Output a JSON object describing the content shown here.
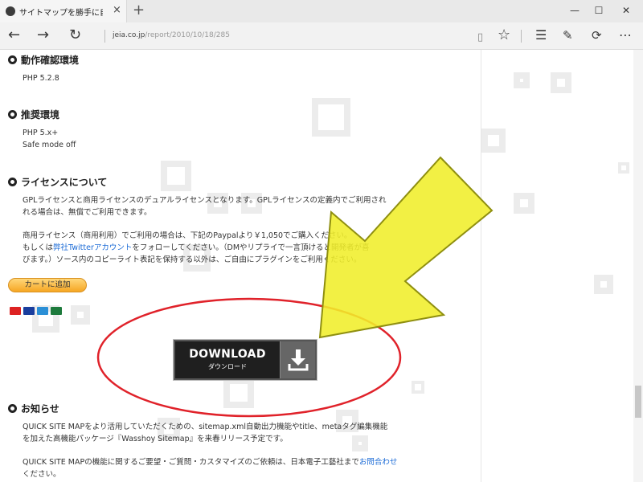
{
  "tab": {
    "title": "サイトマップを勝手に自動作",
    "close": "×",
    "new": "+"
  },
  "window": {
    "min": "—",
    "max": "☐",
    "close": "✕"
  },
  "nav": {
    "back": "←",
    "forward": "→",
    "refresh": "↻",
    "url_domain": "jeia.co.jp",
    "url_path": "/report/2010/10/18/285",
    "reading": "▯",
    "favorite": "☆",
    "hub": "☰",
    "note": "✎",
    "share": "⟳",
    "more": "⋯"
  },
  "sections": {
    "env": {
      "title": "動作確認環境",
      "lines": [
        "PHP 5.2.8"
      ]
    },
    "rec": {
      "title": "推奨環境",
      "lines": [
        "PHP 5.x+",
        "Safe mode off"
      ]
    },
    "license": {
      "title": "ライセンスについて",
      "p1": [
        "GPLライセンスと商用ライセンスのデュアルライセンスとなります。GPLライセンスの定義内でご利用され",
        "れる場合は、無償でご利用できます。"
      ],
      "p2_line1": "商用ライセンス（商用利用）でご利用の場合は、下記のPaypalより￥1,050でご購入ください。",
      "p2_line2_pre": "もしくは",
      "p2_line2_link": "弊社Twitterアカウント",
      "p2_line2_post": "をフォローしてください。（DMやリプライで一言頂けると開発者が喜",
      "p2_line3": "びます。）ソース内のコピーライト表記を保持する以外は、ご自由にプラグインをご利用ください。"
    },
    "news": {
      "title": "お知らせ",
      "p1": [
        "QUICK SITE MAPをより活用していただくための、sitemap.xml自動出力機能やtitle、metaタグ編集機能",
        "を加えた高機能パッケージ『Wasshoy Sitemap』を来春リリース予定です。"
      ],
      "p2_pre": "QUICK SITE MAPの機能に関するご要望・ご質問・カスタマイズのご依頼は、日本電子工藝社まで",
      "p2_link": "お問合わせ",
      "p2_line2": "ください。"
    }
  },
  "cart": {
    "label": "カートに追加"
  },
  "download": {
    "label": "DOWNLOAD",
    "sub": "ダウンロード"
  },
  "colors": {
    "arrow": "#f0ee2a",
    "ellipse": "#e0222a",
    "link": "#1a6ad6"
  }
}
